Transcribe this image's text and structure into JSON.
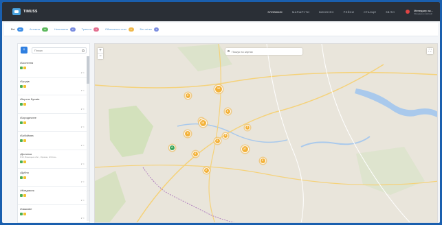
{
  "app": {
    "logo_text": "TIMUSS"
  },
  "nav": {
    "items": [
      {
        "label": "ЗЛОВЖИК"
      },
      {
        "label": "МАРШРУТИ"
      },
      {
        "label": "ВИКОНЕН"
      },
      {
        "label": "РЕЙСИ"
      },
      {
        "label": "СТАНЦІЇ"
      },
      {
        "label": "ЗВІТИ"
      }
    ]
  },
  "user": {
    "name": "Менеджер за...",
    "role": "Менеджер компанії"
  },
  "tabs": [
    {
      "label": "Всі",
      "count": "23",
      "color": "#3d8ee6"
    },
    {
      "label": "Активна",
      "count": "11",
      "color": "#5cb85c"
    },
    {
      "label": "Неактивна",
      "count": "3",
      "color": "#7b8de0"
    },
    {
      "label": "Тривога",
      "count": "4",
      "color": "#e36f8f"
    },
    {
      "label": "Обмеження стан",
      "count": "3",
      "color": "#f0b84a"
    },
    {
      "label": "Без мітки",
      "count": "2",
      "color": "#7b8de0"
    }
  ],
  "sidebar": {
    "search_placeholder": "Пошук",
    "items": [
      {
        "title": "•Боснення",
        "sub": "",
        "count": "2 ☆"
      },
      {
        "title": "•Бродів",
        "sub": "",
        "count": "2 ☆"
      },
      {
        "title": "•Верхнє Бушків",
        "sub": "",
        "count": "2 ☆"
      },
      {
        "title": "•Бородичине",
        "sub": "",
        "count": "2 ☆"
      },
      {
        "title": "•Бобийова",
        "sub": "",
        "count": "2 ☆"
      },
      {
        "title": "•Долинка",
        "sub": "Р.30, Вінницька обл., Україна, 3/24 ва...",
        "count": "2 ☆"
      },
      {
        "title": "•Дубно",
        "sub": "",
        "count": "2 ☆"
      },
      {
        "title": "•Жовджкож",
        "sub": "",
        "count": "2 ☆"
      },
      {
        "title": "•Кашкове",
        "sub": "",
        "count": "2 ☆"
      }
    ]
  },
  "map": {
    "search_placeholder": "Пошук на картах",
    "zoom_in": "+",
    "zoom_out": "−",
    "fullscreen": "⛶",
    "clusters": [
      {
        "label": "3"
      },
      {
        "label": "12"
      },
      {
        "label": "3"
      },
      {
        "label": "2"
      },
      {
        "label": "14"
      },
      {
        "label": "2"
      },
      {
        "label": "4"
      },
      {
        "label": "2"
      },
      {
        "label": "4"
      },
      {
        "label": "2"
      },
      {
        "label": "27"
      },
      {
        "label": "4"
      },
      {
        "label": "2"
      },
      {
        "label": "2"
      }
    ]
  }
}
